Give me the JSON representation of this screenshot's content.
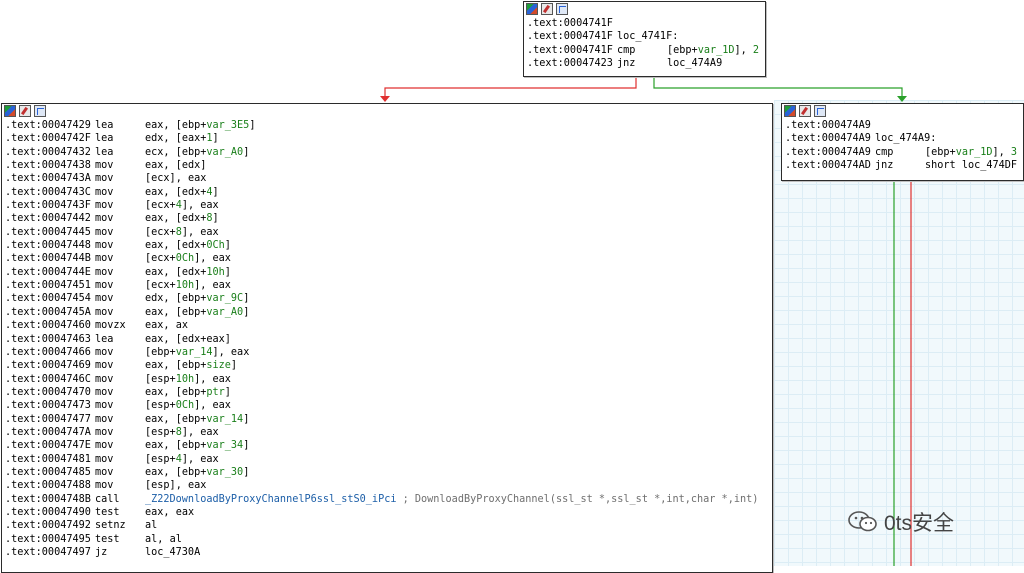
{
  "top_node": {
    "lines": [
      [
        ".text:0004741F",
        "",
        ""
      ],
      [
        ".text:0004741F",
        "loc_4741F:",
        ""
      ],
      [
        ".text:0004741F",
        "cmp",
        "[ebp+var_1D], 2"
      ],
      [
        ".text:00047423",
        "jnz",
        "loc_474A9"
      ]
    ]
  },
  "left_node": {
    "lines": [
      [
        ".text:00047429",
        "lea",
        "eax, [ebp+var_3E5]"
      ],
      [
        ".text:0004742F",
        "lea",
        "edx, [eax+1]"
      ],
      [
        ".text:00047432",
        "lea",
        "ecx, [ebp+var_A0]"
      ],
      [
        ".text:00047438",
        "mov",
        "eax, [edx]"
      ],
      [
        ".text:0004743A",
        "mov",
        "[ecx], eax"
      ],
      [
        ".text:0004743C",
        "mov",
        "eax, [edx+4]"
      ],
      [
        ".text:0004743F",
        "mov",
        "[ecx+4], eax"
      ],
      [
        ".text:00047442",
        "mov",
        "eax, [edx+8]"
      ],
      [
        ".text:00047445",
        "mov",
        "[ecx+8], eax"
      ],
      [
        ".text:00047448",
        "mov",
        "eax, [edx+0Ch]"
      ],
      [
        ".text:0004744B",
        "mov",
        "[ecx+0Ch], eax"
      ],
      [
        ".text:0004744E",
        "mov",
        "eax, [edx+10h]"
      ],
      [
        ".text:00047451",
        "mov",
        "[ecx+10h], eax"
      ],
      [
        ".text:00047454",
        "mov",
        "edx, [ebp+var_9C]"
      ],
      [
        ".text:0004745A",
        "mov",
        "eax, [ebp+var_A0]"
      ],
      [
        ".text:00047460",
        "movzx",
        "eax, ax"
      ],
      [
        ".text:00047463",
        "lea",
        "eax, [edx+eax]"
      ],
      [
        ".text:00047466",
        "mov",
        "[ebp+var_14], eax"
      ],
      [
        ".text:00047469",
        "mov",
        "eax, [ebp+size]"
      ],
      [
        ".text:0004746C",
        "mov",
        "[esp+10h], eax"
      ],
      [
        ".text:00047470",
        "mov",
        "eax, [ebp+ptr]"
      ],
      [
        ".text:00047473",
        "mov",
        "[esp+0Ch], eax"
      ],
      [
        ".text:00047477",
        "mov",
        "eax, [ebp+var_14]"
      ],
      [
        ".text:0004747A",
        "mov",
        "[esp+8], eax"
      ],
      [
        ".text:0004747E",
        "mov",
        "eax, [ebp+var_34]"
      ],
      [
        ".text:00047481",
        "mov",
        "[esp+4], eax"
      ],
      [
        ".text:00047485",
        "mov",
        "eax, [ebp+var_30]"
      ],
      [
        ".text:00047488",
        "mov",
        "[esp], eax"
      ],
      [
        ".text:0004748B",
        "call",
        "_Z22DownloadByProxyChannelP6ssl_stS0_iPci",
        "; DownloadByProxyChannel(ssl_st *,ssl_st *,int,char *,int)"
      ],
      [
        ".text:00047490",
        "test",
        "eax, eax"
      ],
      [
        ".text:00047492",
        "setnz",
        "al"
      ],
      [
        ".text:00047495",
        "test",
        "al, al"
      ],
      [
        ".text:00047497",
        "jz",
        "loc_4730A"
      ]
    ]
  },
  "right_node": {
    "lines": [
      [
        ".text:000474A9",
        "",
        ""
      ],
      [
        ".text:000474A9",
        "loc_474A9:",
        ""
      ],
      [
        ".text:000474A9",
        "cmp",
        "[ebp+var_1D], 3"
      ],
      [
        ".text:000474AD",
        "jnz",
        "short loc_474DF"
      ]
    ]
  },
  "edge_colors": {
    "false_branch": "#e03030",
    "true_branch": "#2aa02a"
  },
  "watermark": {
    "text": "0ts安全"
  }
}
